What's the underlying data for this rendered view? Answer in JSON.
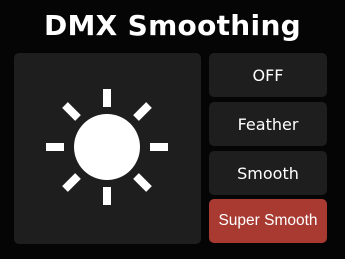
{
  "app": {
    "title": "DMX Smoothing"
  },
  "preview": {
    "icon": "sun-icon",
    "icon_color": "#ffffff"
  },
  "options": [
    {
      "label": "OFF",
      "selected": false
    },
    {
      "label": "Feather",
      "selected": false
    },
    {
      "label": "Smooth",
      "selected": false
    },
    {
      "label": "Super Smooth",
      "selected": true
    }
  ],
  "colors": {
    "background": "#050505",
    "panel": "#1e1e1e",
    "selected": "#a83a32",
    "text": "#ffffff"
  }
}
